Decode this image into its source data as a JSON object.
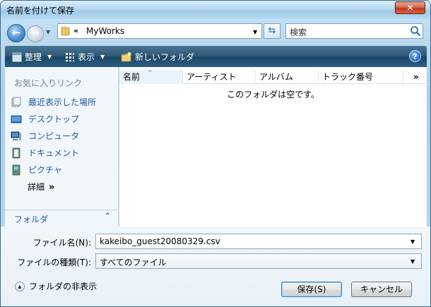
{
  "window": {
    "title": "名前を付けて保存",
    "close_label": "✕"
  },
  "navigation": {
    "address_chevron": "«",
    "address_path": "MyWorks",
    "search_placeholder": "検索"
  },
  "toolbar": {
    "organize_label": "整理",
    "view_label": "表示",
    "new_folder_label": "新しいフォルダ",
    "help_label": "?"
  },
  "sidebar": {
    "heading": "お気に入りリンク",
    "links": [
      {
        "label": "最近表示した場所",
        "icon": "recent-places-icon"
      },
      {
        "label": "デスクトップ",
        "icon": "desktop-icon"
      },
      {
        "label": "コンピュータ",
        "icon": "computer-icon"
      },
      {
        "label": "ドキュメント",
        "icon": "documents-icon"
      },
      {
        "label": "ピクチャ",
        "icon": "pictures-icon"
      }
    ],
    "details_label": "詳細",
    "details_arrow": "»",
    "folders_label": "フォルダ",
    "folders_caret": "⌃"
  },
  "file_list": {
    "columns": [
      "名前",
      "アーティスト",
      "アルバム",
      "トラック番号"
    ],
    "more_columns": "»",
    "empty_message": "このフォルダは空です。"
  },
  "form": {
    "filename_label": "ファイル名(N):",
    "filename_value": "kakeibo_guest20080329.csv",
    "filetype_label": "ファイルの種類(T):",
    "filetype_value": "すべてのファイル",
    "hide_folders_label": "フォルダの非表示",
    "save_label": "保存(S)",
    "cancel_label": "キャンセル"
  },
  "colors": {
    "link_blue": "#1f57a8",
    "toolbar_dark": "#1a4666",
    "close_red": "#c0391d"
  }
}
